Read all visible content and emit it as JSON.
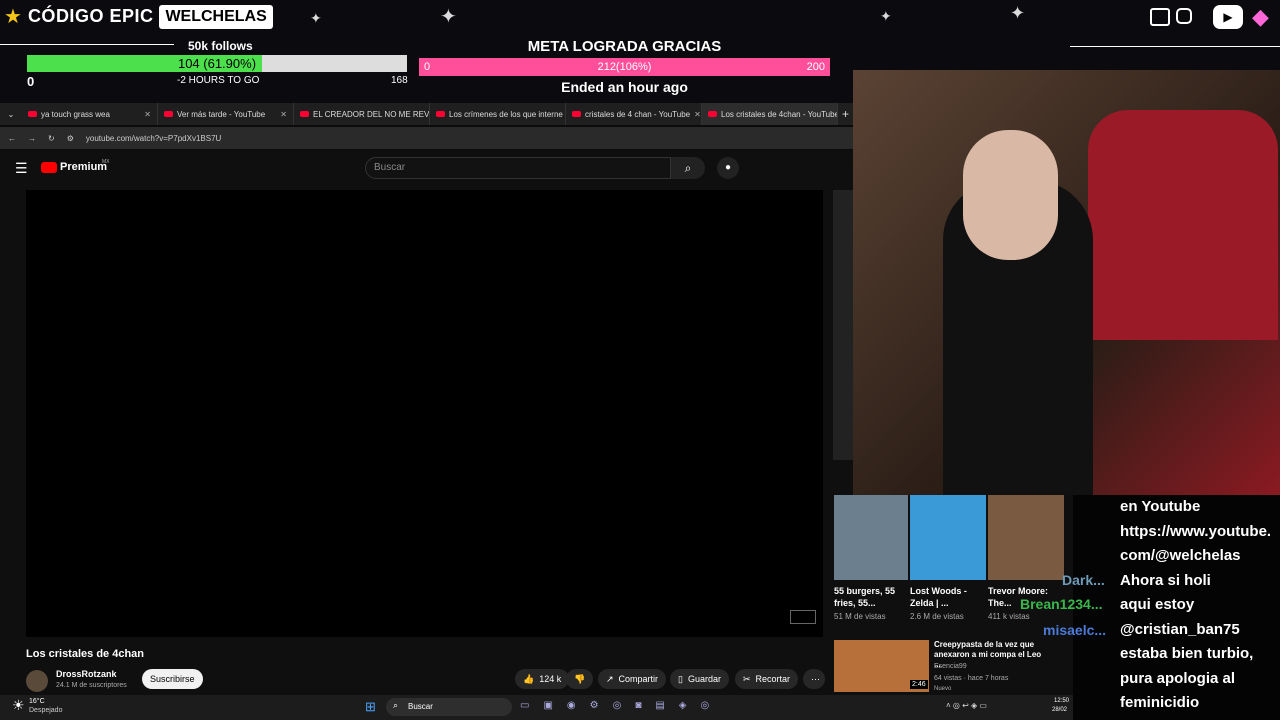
{
  "overlay": {
    "brand1": "CÓDIGO EPIC",
    "brand2": "WELCHELAS",
    "follows_label": "50k follows",
    "follows_bar": "104 (61.90%)",
    "follows_progress": 0.619,
    "follows_min": "0",
    "follows_remaining": "-2 HOURS TO GO",
    "follows_max": "168",
    "meta_title": "META LOGRADA GRACIAS",
    "meta_min": "0",
    "meta_bar": "212(106%)",
    "meta_max": "200",
    "meta_status": "Ended an hour ago"
  },
  "browser": {
    "tabs": [
      "ya touch grass wea",
      "Ver más tarde - YouTube",
      "EL CREADOR DEL NO ME REVIE",
      "Los crímenes de los que interne",
      "cristales de 4 chan - YouTube",
      "Los cristales de 4chan - YouTube"
    ],
    "url": "youtube.com/watch?v=P7pdXv1BS7U"
  },
  "youtube": {
    "logo": "Premium",
    "logo_region": "MX",
    "search_placeholder": "Buscar",
    "video_title": "Los cristales de 4chan",
    "channel": "DrossRotzank",
    "subs": "24.1 M de suscriptores",
    "subscribe": "Suscribirse",
    "likes": "124 k",
    "share": "Compartir",
    "save": "Guardar",
    "clip": "Recortar",
    "recs": [
      {
        "title": "55 burgers, 55 fries, 55...",
        "meta": "51 M de vistas"
      },
      {
        "title": "Lost Woods - Zelda | ...",
        "meta": "2.6 M de vistas"
      },
      {
        "title": "Trevor Moore: The...",
        "meta": "411 k vistas"
      }
    ],
    "rec_list": {
      "title": "Creepypasta de la vez que anexaron a mi compa el Leo ...",
      "channel": "Esencia99",
      "meta": "64 vistas · hace 7 horas",
      "badge": "Nuevo",
      "duration": "2:46"
    }
  },
  "chat": {
    "lines": [
      "en Youtube",
      "https://www.youtube.",
      "com/@welchelas",
      "Ahora si holi",
      "aqui estoy",
      "@cristian_ban75",
      "estaba bien turbio,",
      "pura apologia al",
      "feminicidio"
    ],
    "users": [
      "Dark...",
      "Brean1234...",
      "misaelc..."
    ]
  },
  "taskbar": {
    "temp": "16°C",
    "weather": "Despejado",
    "search": "Buscar",
    "time": "12:50",
    "date": "28/02"
  }
}
